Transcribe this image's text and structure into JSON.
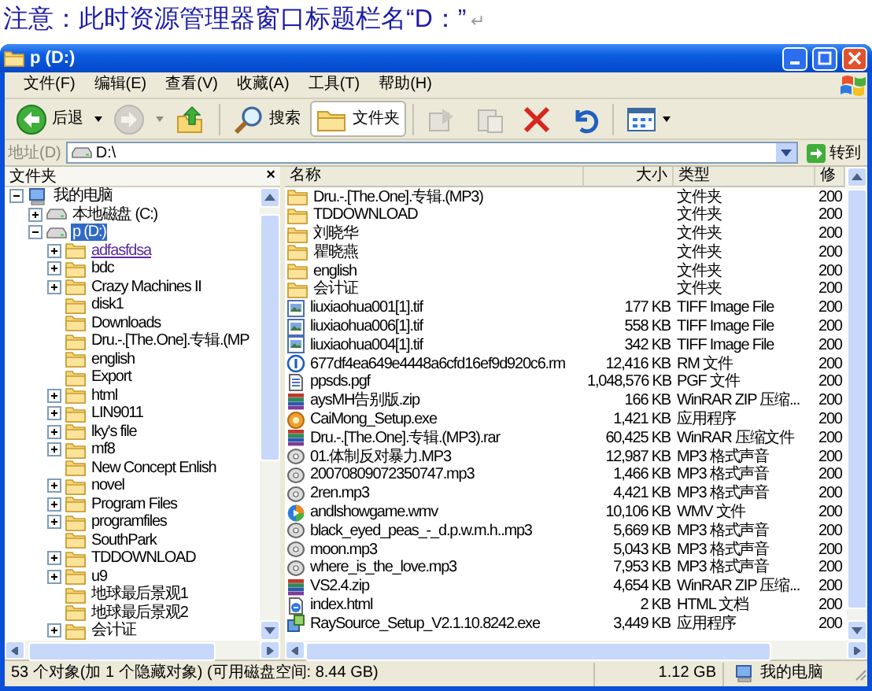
{
  "caption": {
    "text": "注意：此时资源管理器窗口标题栏名“D：”",
    "mark": "↵"
  },
  "window": {
    "title": "p (D:)"
  },
  "menu": [
    "文件(F)",
    "编辑(E)",
    "查看(V)",
    "收藏(A)",
    "工具(T)",
    "帮助(H)"
  ],
  "toolbar": [
    {
      "kind": "back",
      "label": "后退",
      "disabled": false,
      "pressed": false
    },
    {
      "kind": "forward",
      "disabled": true,
      "pressed": false
    },
    {
      "kind": "up",
      "disabled": false,
      "pressed": false
    },
    {
      "kind": "search",
      "label": "搜索",
      "disabled": false,
      "pressed": false
    },
    {
      "kind": "folders",
      "label": "文件夹",
      "disabled": false,
      "pressed": true
    },
    {
      "kind": "move",
      "disabled": true,
      "pressed": false
    },
    {
      "kind": "copy",
      "disabled": true,
      "pressed": false
    },
    {
      "kind": "delete",
      "disabled": false,
      "pressed": false
    },
    {
      "kind": "undo",
      "disabled": false,
      "pressed": false
    },
    {
      "kind": "views",
      "disabled": false,
      "pressed": false
    }
  ],
  "address": {
    "label": "地址(D)",
    "value": "D:\\",
    "go": "转到"
  },
  "tree": {
    "title": "文件夹",
    "close": "×",
    "items": [
      {
        "label": "我的电脑",
        "kind": "computer",
        "expanded": true,
        "selected": false,
        "hot": false,
        "children": [
          {
            "label": "本地磁盘 (C:)",
            "kind": "drive",
            "expanded": false,
            "selected": false,
            "hot": false
          },
          {
            "label": "p (D:)",
            "kind": "drive",
            "expanded": true,
            "selected": true,
            "hot": false,
            "children": [
              {
                "label": "adfasfdsa",
                "expanded": false,
                "selected": false,
                "hot": true
              },
              {
                "label": "bdc",
                "expanded": false,
                "selected": false,
                "hot": false
              },
              {
                "label": "Crazy Machines II",
                "expanded": false,
                "selected": false,
                "hot": false
              },
              {
                "label": "disk1",
                "selected": false,
                "hot": false
              },
              {
                "label": "Downloads",
                "selected": false,
                "hot": false
              },
              {
                "label": "Dru.-.[The.One].专辑.(MP",
                "selected": false,
                "hot": false
              },
              {
                "label": "english",
                "selected": false,
                "hot": false
              },
              {
                "label": "Export",
                "selected": false,
                "hot": false
              },
              {
                "label": "html",
                "expanded": false,
                "selected": false,
                "hot": false
              },
              {
                "label": "LIN9011",
                "expanded": false,
                "selected": false,
                "hot": false
              },
              {
                "label": "lky's file",
                "expanded": false,
                "selected": false,
                "hot": false
              },
              {
                "label": "mf8",
                "expanded": false,
                "selected": false,
                "hot": false
              },
              {
                "label": "New Concept Enlish",
                "selected": false,
                "hot": false
              },
              {
                "label": "novel",
                "expanded": false,
                "selected": false,
                "hot": false
              },
              {
                "label": "Program Files",
                "expanded": false,
                "selected": false,
                "hot": false
              },
              {
                "label": "programfiles",
                "expanded": false,
                "selected": false,
                "hot": false
              },
              {
                "label": "SouthPark",
                "selected": false,
                "hot": false
              },
              {
                "label": "TDDOWNLOAD",
                "expanded": false,
                "selected": false,
                "hot": false
              },
              {
                "label": "u9",
                "expanded": false,
                "selected": false,
                "hot": false
              },
              {
                "label": "地球最后景观1",
                "selected": false,
                "hot": false
              },
              {
                "label": "地球最后景观2",
                "selected": false,
                "hot": false
              },
              {
                "label": "会计证",
                "expanded": false,
                "selected": false,
                "hot": false
              }
            ]
          }
        ]
      }
    ]
  },
  "list": {
    "columns": [
      "名称",
      "大小",
      "类型",
      "修"
    ],
    "rows": [
      {
        "name": "Dru.-.[The.One].专辑.(MP3)",
        "size": "",
        "type": "文件夹",
        "date": "200",
        "kind": "folder"
      },
      {
        "name": "TDDOWNLOAD",
        "size": "",
        "type": "文件夹",
        "date": "200",
        "kind": "folder"
      },
      {
        "name": "刘晓华",
        "size": "",
        "type": "文件夹",
        "date": "200",
        "kind": "folder"
      },
      {
        "name": "瞿晓燕",
        "size": "",
        "type": "文件夹",
        "date": "200",
        "kind": "folder"
      },
      {
        "name": "english",
        "size": "",
        "type": "文件夹",
        "date": "200",
        "kind": "folder"
      },
      {
        "name": "会计证",
        "size": "",
        "type": "文件夹",
        "date": "200",
        "kind": "folder"
      },
      {
        "name": "liuxiaohua001[1].tif",
        "size": "177 KB",
        "type": "TIFF Image File",
        "date": "200",
        "kind": "image"
      },
      {
        "name": "liuxiaohua006[1].tif",
        "size": "558 KB",
        "type": "TIFF Image File",
        "date": "200",
        "kind": "image"
      },
      {
        "name": "liuxiaohua004[1].tif",
        "size": "342 KB",
        "type": "TIFF Image File",
        "date": "200",
        "kind": "image"
      },
      {
        "name": "677df4ea649e4448a6cfd16ef9d920c6.rm",
        "size": "12,416 KB",
        "type": "RM 文件",
        "date": "200",
        "kind": "media"
      },
      {
        "name": "ppsds.pgf",
        "size": "1,048,576 KB",
        "type": "PGF 文件",
        "date": "200",
        "kind": "document"
      },
      {
        "name": "aysMH告别版.zip",
        "size": "166 KB",
        "type": "WinRAR ZIP 压缩...",
        "date": "200",
        "kind": "archive"
      },
      {
        "name": "CaiMong_Setup.exe",
        "size": "1,421 KB",
        "type": "应用程序",
        "date": "200",
        "kind": "program"
      },
      {
        "name": "Dru.-.[The.One].专辑.(MP3).rar",
        "size": "60,425 KB",
        "type": "WinRAR 压缩文件",
        "date": "200",
        "kind": "archive"
      },
      {
        "name": "01.体制反对暴力.MP3",
        "size": "12,987 KB",
        "type": "MP3 格式声音",
        "date": "200",
        "kind": "audio"
      },
      {
        "name": "20070809072350747.mp3",
        "size": "1,466 KB",
        "type": "MP3 格式声音",
        "date": "200",
        "kind": "audio"
      },
      {
        "name": "2ren.mp3",
        "size": "4,421 KB",
        "type": "MP3 格式声音",
        "date": "200",
        "kind": "audio"
      },
      {
        "name": "andlshowgame.wmv",
        "size": "10,106 KB",
        "type": "WMV 文件",
        "date": "200",
        "kind": "video"
      },
      {
        "name": "black_eyed_peas_-_d.p.w.m.h..mp3",
        "size": "5,669 KB",
        "type": "MP3 格式声音",
        "date": "200",
        "kind": "audio"
      },
      {
        "name": "moon.mp3",
        "size": "5,043 KB",
        "type": "MP3 格式声音",
        "date": "200",
        "kind": "audio"
      },
      {
        "name": "where_is_the_love.mp3",
        "size": "7,953 KB",
        "type": "MP3 格式声音",
        "date": "200",
        "kind": "audio"
      },
      {
        "name": "VS2.4.zip",
        "size": "4,654 KB",
        "type": "WinRAR ZIP 压缩...",
        "date": "200",
        "kind": "archive"
      },
      {
        "name": "index.html",
        "size": "2 KB",
        "type": "HTML 文档",
        "date": "200",
        "kind": "web"
      },
      {
        "name": "RaySource_Setup_V2.1.10.8242.exe",
        "size": "3,449 KB",
        "type": "应用程序",
        "date": "200",
        "kind": "installer"
      }
    ]
  },
  "status": {
    "objects": "53 个对象(加 1 个隐藏对象) (可用磁盘空间: 8.44 GB)",
    "size": "1.12 GB",
    "zone": "我的电脑"
  }
}
